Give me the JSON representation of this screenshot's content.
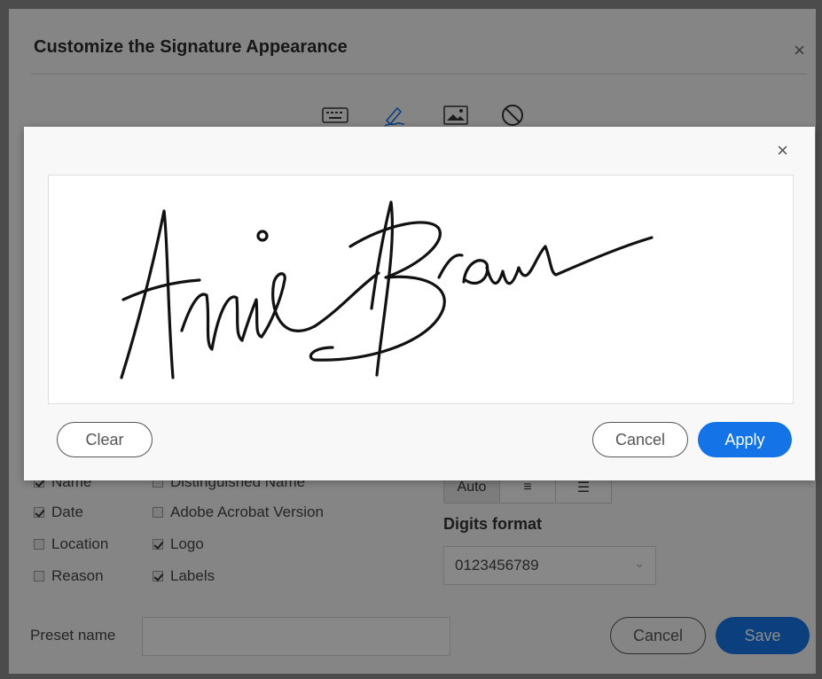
{
  "background_dialog": {
    "title": "Customize the Signature Appearance",
    "close_label": "×",
    "modes": [
      {
        "icon": "keyboard-icon"
      },
      {
        "icon": "pen-draw-icon",
        "active": true
      },
      {
        "icon": "image-icon"
      },
      {
        "icon": "no-icon"
      }
    ],
    "checkboxes": [
      {
        "label": "Name",
        "checked": true
      },
      {
        "label": "Distinguished Name",
        "checked": false
      },
      {
        "label": "Date",
        "checked": true
      },
      {
        "label": "Adobe Acrobat Version",
        "checked": false
      },
      {
        "label": "Location",
        "checked": false
      },
      {
        "label": "Logo",
        "checked": true
      },
      {
        "label": "Reason",
        "checked": false
      },
      {
        "label": "Labels",
        "checked": true
      }
    ],
    "alignment": {
      "options": [
        "Auto",
        "≡",
        "☰"
      ],
      "selected": "Auto"
    },
    "digits_format": {
      "label": "Digits format",
      "value": "0123456789"
    },
    "preset": {
      "label": "Preset name",
      "value": ""
    },
    "cancel_label": "Cancel",
    "save_label": "Save"
  },
  "draw_modal": {
    "close_label": "×",
    "signature_text": "Annie Brown",
    "clear_label": "Clear",
    "cancel_label": "Cancel",
    "apply_label": "Apply"
  },
  "colors": {
    "accent": "#1473e6",
    "overlay": "rgba(0,0,0,0.45)"
  }
}
